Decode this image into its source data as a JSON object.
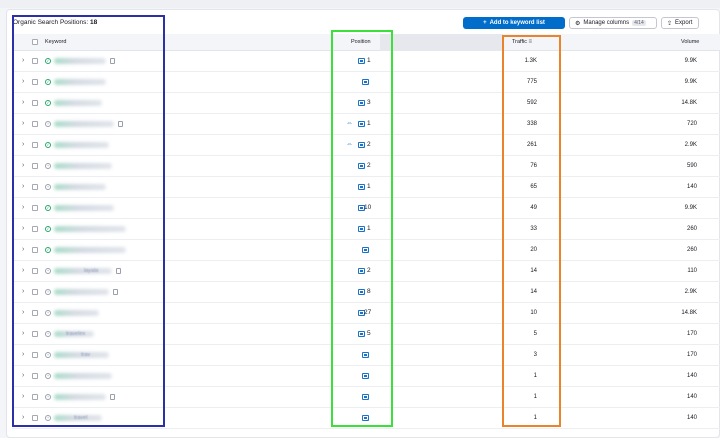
{
  "header": {
    "title_prefix": "Organic Search Positions:",
    "title_count": "18",
    "add_button": "Add to keyword list",
    "add_icon": "+",
    "columns_button": "Manage columns",
    "columns_badge": "4/14",
    "export_button": "Export"
  },
  "columns": {
    "keyword": "Keyword",
    "position": "Position",
    "traffic": "Traffic",
    "volume": "Volume"
  },
  "icons": {
    "chevron": "›",
    "link": "⇔",
    "gear": "⚙",
    "export": "⇪",
    "sort": "≡",
    "check": "✓",
    "plus_circle": "+"
  },
  "colors": {
    "accent": "#006dca",
    "annotation_blue": "#2b2fa8",
    "annotation_green": "#3de03a",
    "annotation_orange": "#e9842a"
  },
  "rows": [
    {
      "status": "green",
      "kw_text": "",
      "blur_w": 52,
      "doc": true,
      "link": false,
      "serp": true,
      "position": "1",
      "traffic": "1.3K",
      "volume": "9.9K"
    },
    {
      "status": "green",
      "kw_text": "",
      "blur_w": 52,
      "doc": false,
      "link": false,
      "serp": true,
      "position": "",
      "traffic": "775",
      "volume": "9.9K"
    },
    {
      "status": "green",
      "kw_text": "",
      "blur_w": 48,
      "doc": false,
      "link": false,
      "serp": true,
      "position": "3",
      "traffic": "592",
      "volume": "14.8K"
    },
    {
      "status": "plus",
      "kw_text": "",
      "blur_w": 60,
      "doc": true,
      "link": true,
      "serp": true,
      "position": "1",
      "traffic": "338",
      "volume": "720"
    },
    {
      "status": "green",
      "kw_text": "",
      "blur_w": 55,
      "doc": false,
      "link": true,
      "serp": true,
      "position": "2",
      "traffic": "261",
      "volume": "2.9K"
    },
    {
      "status": "plus",
      "kw_text": "",
      "blur_w": 58,
      "doc": false,
      "link": false,
      "serp": true,
      "position": "2",
      "traffic": "76",
      "volume": "590"
    },
    {
      "status": "plus",
      "kw_text": "",
      "blur_w": 52,
      "doc": false,
      "link": false,
      "serp": true,
      "position": "1",
      "traffic": "65",
      "volume": "140"
    },
    {
      "status": "green",
      "kw_text": "",
      "blur_w": 60,
      "doc": false,
      "link": false,
      "serp": true,
      "position": "10",
      "traffic": "49",
      "volume": "9.9K"
    },
    {
      "status": "green",
      "kw_text": "",
      "blur_w": 72,
      "doc": false,
      "link": false,
      "serp": true,
      "position": "1",
      "traffic": "33",
      "volume": "260"
    },
    {
      "status": "green",
      "kw_text": "",
      "blur_w": 72,
      "doc": false,
      "link": false,
      "serp": true,
      "position": "",
      "traffic": "20",
      "volume": "260"
    },
    {
      "status": "plus",
      "kw_text": "layala",
      "blur_w": 58,
      "doc": true,
      "link": false,
      "serp": true,
      "position": "2",
      "traffic": "14",
      "volume": "110"
    },
    {
      "status": "plus",
      "kw_text": "",
      "blur_w": 55,
      "doc": true,
      "link": false,
      "serp": true,
      "position": "8",
      "traffic": "14",
      "volume": "2.9K"
    },
    {
      "status": "plus",
      "kw_text": "",
      "blur_w": 45,
      "doc": false,
      "link": false,
      "serp": true,
      "position": "27",
      "traffic": "10",
      "volume": "14.8K"
    },
    {
      "status": "plus",
      "kw_text": "travelex",
      "blur_w": 40,
      "doc": false,
      "link": false,
      "serp": true,
      "position": "5",
      "traffic": "5",
      "volume": "170"
    },
    {
      "status": "plus",
      "kw_text": "trav",
      "blur_w": 55,
      "doc": false,
      "link": false,
      "serp": true,
      "position": "",
      "traffic": "3",
      "volume": "170"
    },
    {
      "status": "plus",
      "kw_text": "",
      "blur_w": 58,
      "doc": false,
      "link": false,
      "serp": true,
      "position": "",
      "traffic": "1",
      "volume": "140"
    },
    {
      "status": "plus",
      "kw_text": "",
      "blur_w": 52,
      "doc": true,
      "link": false,
      "serp": true,
      "position": "",
      "traffic": "1",
      "volume": "140"
    },
    {
      "status": "plus",
      "kw_text": "travel",
      "blur_w": 48,
      "doc": false,
      "link": false,
      "serp": true,
      "position": "",
      "traffic": "1",
      "volume": "140"
    }
  ]
}
